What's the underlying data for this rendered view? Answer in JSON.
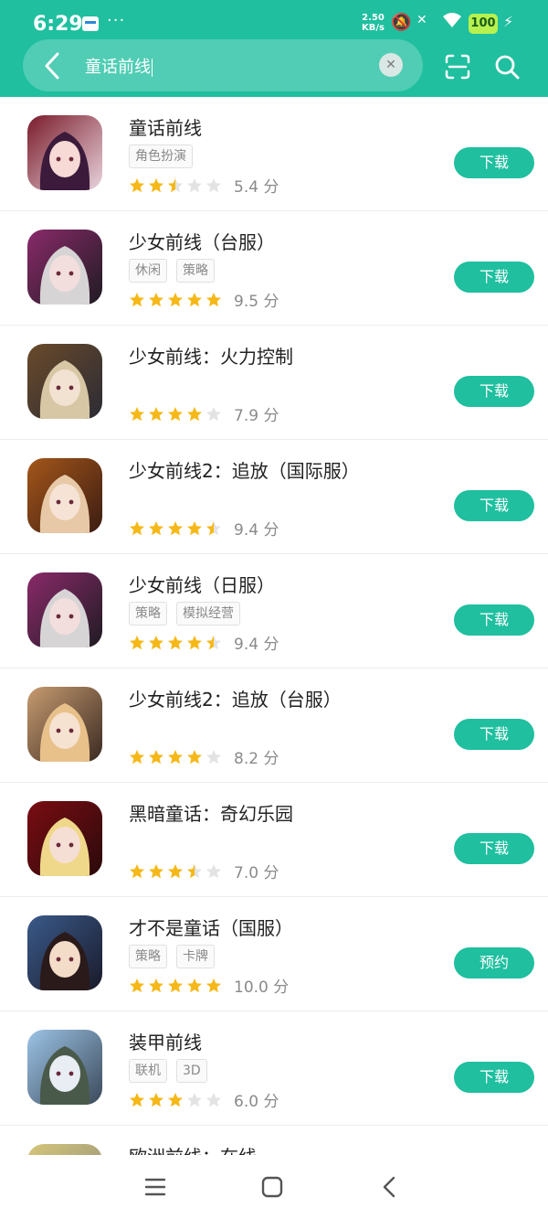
{
  "status": {
    "time": "6:29",
    "net_speed": "2.50",
    "net_unit": "KB/s",
    "battery": "100"
  },
  "search": {
    "query": "童话前线"
  },
  "apps": [
    {
      "title": "童话前线",
      "tags": [
        "角色扮演"
      ],
      "rating": 2.5,
      "score": "5.4 分",
      "button": "下载",
      "icon": {
        "bg1": "#7a1b2a",
        "bg2": "#e8d3dc",
        "hair": "#3b1a3b",
        "face": "#f7d9d5"
      }
    },
    {
      "title": "少女前线（台服）",
      "tags": [
        "休闲",
        "策略"
      ],
      "rating": 5,
      "score": "9.5 分",
      "button": "下载",
      "icon": {
        "bg1": "#8a2a6a",
        "bg2": "#1f1b22",
        "hair": "#d7d4d6",
        "face": "#f3dede"
      }
    },
    {
      "title": "少女前线：火力控制",
      "tags": [],
      "rating": 4,
      "score": "7.9 分",
      "button": "下载",
      "icon": {
        "bg1": "#6a4a2a",
        "bg2": "#2b2b35",
        "hair": "#d8c7a4",
        "face": "#f2e2d2"
      }
    },
    {
      "title": "少女前线2：追放（国际服）",
      "tags": [],
      "rating": 4.5,
      "score": "9.4 分",
      "button": "下载",
      "icon": {
        "bg1": "#a4561a",
        "bg2": "#3b1c12",
        "hair": "#e7c9a7",
        "face": "#f6e3d6"
      }
    },
    {
      "title": "少女前线（日服）",
      "tags": [
        "策略",
        "模拟经营"
      ],
      "rating": 4.5,
      "score": "9.4 分",
      "button": "下载",
      "icon": {
        "bg1": "#8a2a6a",
        "bg2": "#1f1b22",
        "hair": "#d7d4d6",
        "face": "#f3dede"
      }
    },
    {
      "title": "少女前线2：追放（台服）",
      "tags": [],
      "rating": 4,
      "score": "8.2 分",
      "button": "下载",
      "icon": {
        "bg1": "#c79b70",
        "bg2": "#3a2a22",
        "hair": "#e8c08a",
        "face": "#f6e2d0"
      }
    },
    {
      "title": "黑暗童话：奇幻乐园",
      "tags": [],
      "rating": 3.5,
      "score": "7.0 分",
      "button": "下载",
      "icon": {
        "bg1": "#7a0d12",
        "bg2": "#2a0a0c",
        "hair": "#f0d88a",
        "face": "#f5ded4"
      }
    },
    {
      "title": "才不是童话（国服）",
      "tags": [
        "策略",
        "卡牌"
      ],
      "rating": 5,
      "score": "10.0 分",
      "button": "预约",
      "icon": {
        "bg1": "#3a5a8a",
        "bg2": "#1a1a2a",
        "hair": "#2a1a1a",
        "face": "#f3dcc8"
      }
    },
    {
      "title": "装甲前线",
      "tags": [
        "联机",
        "3D"
      ],
      "rating": 3,
      "score": "6.0 分",
      "button": "下载",
      "icon": {
        "bg1": "#9cc3e6",
        "bg2": "#3b4a5a",
        "hair": "#4a5a4a",
        "face": "#e8eef4"
      }
    },
    {
      "title": "欧洲前线：在线",
      "tags": [],
      "rating": 0,
      "score": "",
      "button": "",
      "icon": {
        "bg1": "#d6c67a",
        "bg2": "#8a8a7a",
        "hair": "#bdb07a",
        "face": "#e9e4cf"
      }
    }
  ],
  "colors": {
    "accent": "#1fbf9f",
    "star": "#f5b818",
    "star_empty": "#e3e3e3"
  }
}
